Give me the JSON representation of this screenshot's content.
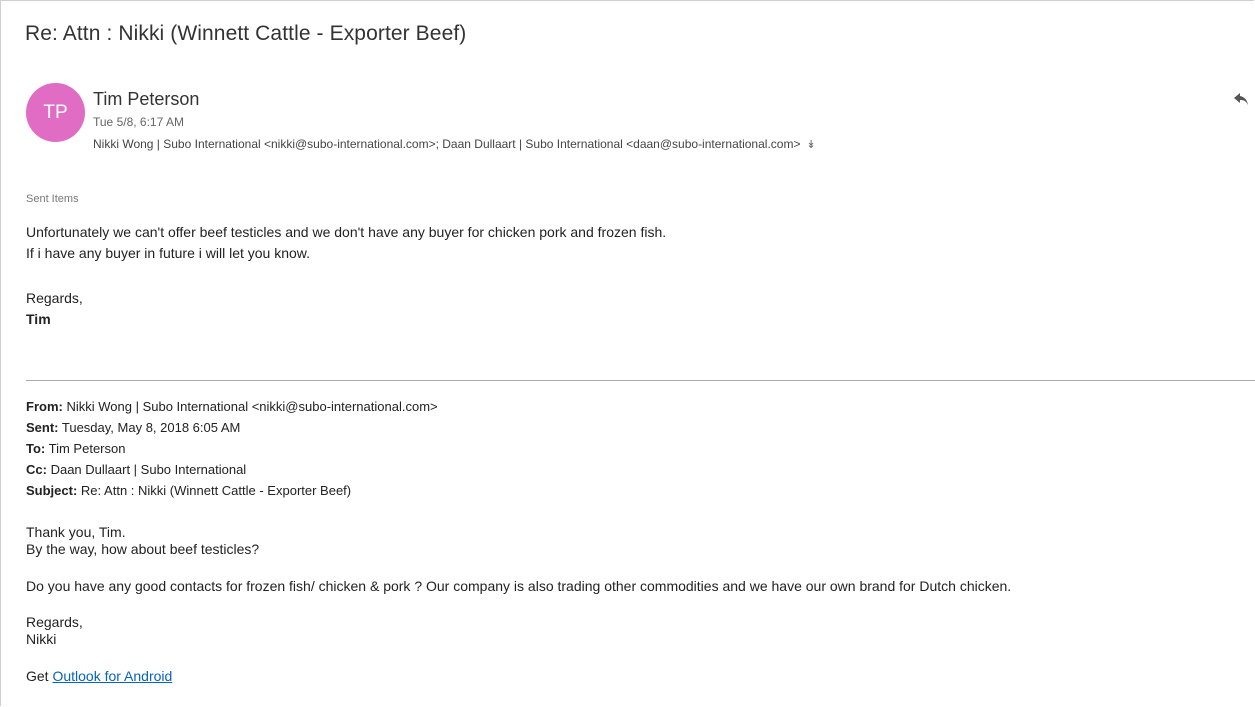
{
  "email": {
    "subject": "Re: Attn : Nikki (Winnett Cattle - Exporter Beef)",
    "avatar_initials": "TP",
    "avatar_color": "#e06cc4",
    "sender": "Tim Peterson",
    "date": "Tue 5/8, 6:17 AM",
    "recipients": "Nikki Wong | Subo International <nikki@subo-international.com>; Daan Dullaart | Subo International <daan@subo-international.com>",
    "expand_icon": "double-chevron-down-icon",
    "reply_icon": "reply-arrow-icon",
    "folder": "Sent Items",
    "body": {
      "line1": "Unfortunately we can't offer beef testicles and we don't have any buyer for chicken pork and frozen fish.",
      "line2": "If i have any buyer in future i will let you know.",
      "regards": "Regards,",
      "signature": "Tim"
    }
  },
  "quoted": {
    "from_label": "From:",
    "from_value": "Nikki Wong | Subo International <nikki@subo-international.com>",
    "sent_label": "Sent:",
    "sent_value": "Tuesday, May 8, 2018 6:05 AM",
    "to_label": "To:",
    "to_value": "Tim Peterson",
    "cc_label": "Cc:",
    "cc_value": "Daan Dullaart | Subo International",
    "subject_label": "Subject:",
    "subject_value": "Re: Attn : Nikki (Winnett Cattle - Exporter Beef)",
    "body": {
      "line1": "Thank you, Tim.",
      "line2": "By the way, how about beef testicles?",
      "line3": "Do you have any good contacts for frozen fish/ chicken & pork ? Our company is also trading other  commodities and we have our own brand for Dutch chicken.",
      "regards": "Regards,",
      "signature": "Nikki",
      "get_prefix": "Get ",
      "link_text": "Outlook for Android"
    }
  }
}
